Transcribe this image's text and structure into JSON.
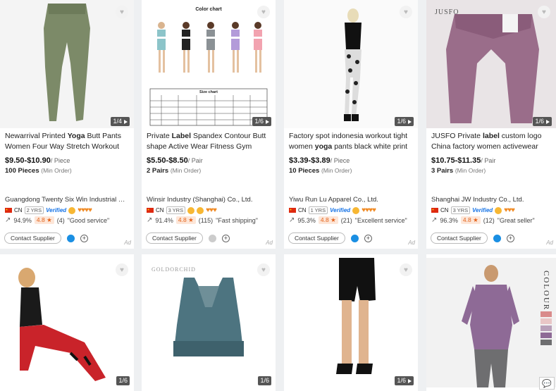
{
  "cards": [
    {
      "title_pre": "Newarrival Printed ",
      "title_bold": "Yoga",
      "title_post": " Butt Pants Women Four Way Stretch Workout Bottoms Gym",
      "price": "$9.50-$10.90",
      "unit": "/ Piece",
      "moq": "100 Pieces",
      "moq_note": "(Min Order)",
      "supplier": "Guangdong Twenty Six Win Industrial Co.,...",
      "country": "CN",
      "years": "2 YRS",
      "verified": "Verified",
      "response": "94.9%",
      "score": "4.8 ★",
      "reviews": "(4)",
      "review_text": "\"Good service\"",
      "contact": "Contact Supplier",
      "counter": "1/4",
      "ad": "Ad"
    },
    {
      "title_pre": "Private ",
      "title_bold": "Label",
      "title_post": " Spandex Contour Butt shape Active Wear Fitness Gym Workout",
      "price": "$5.50-$8.50",
      "unit": "/ Pair",
      "moq": "2 Pairs",
      "moq_note": "(Min Order)",
      "supplier": "Winsir Industry (Shanghai) Co., Ltd.",
      "country": "CN",
      "years": "3 YRS",
      "verified": "",
      "response": "91.4%",
      "score": "4.8 ★",
      "reviews": "(115)",
      "review_text": "\"Fast shipping\"",
      "contact": "Contact Supplier",
      "counter": "1/6",
      "ad": "Ad",
      "chart_title": "Color chart",
      "size_title": "Size chart"
    },
    {
      "title_pre": "Factory spot indonesia workout tight women ",
      "title_bold": "yoga",
      "title_post": " pants black white print",
      "price": "$3.39-$3.89",
      "unit": "/ Piece",
      "moq": "10 Pieces",
      "moq_note": "(Min Order)",
      "supplier": "Yiwu Run Lu Apparel Co., Ltd.",
      "country": "CN",
      "years": "1 YRS",
      "verified": "Verified",
      "response": "95.3%",
      "score": "4.8 ★",
      "reviews": "(21)",
      "review_text": "\"Excellent service\"",
      "contact": "Contact Supplier",
      "counter": "1/6",
      "ad": "Ad"
    },
    {
      "title_pre": "JUSFO Private ",
      "title_bold": "label",
      "title_post": " custom logo China factory women activewear fitness running",
      "price": "$10.75-$11.35",
      "unit": "/ Pair",
      "moq": "3 Pairs",
      "moq_note": "(Min Order)",
      "supplier": "Shanghai JW Industry Co., Ltd.",
      "country": "CN",
      "years": "3 YRS",
      "verified": "Verified",
      "response": "96.3%",
      "score": "4.8 ★",
      "reviews": "(12)",
      "review_text": "\"Great seller\"",
      "contact": "Contact Supplier",
      "counter": "1/6",
      "ad": "Ad",
      "brand": "JUSFO"
    }
  ],
  "row2": [
    {
      "counter": "1/6"
    },
    {
      "counter": "1/6",
      "brand": "GOLDORCHID"
    },
    {
      "counter": "1/6"
    },
    {
      "colour": "COLOUR"
    }
  ],
  "chat_icon": "chat-bubble-icon"
}
